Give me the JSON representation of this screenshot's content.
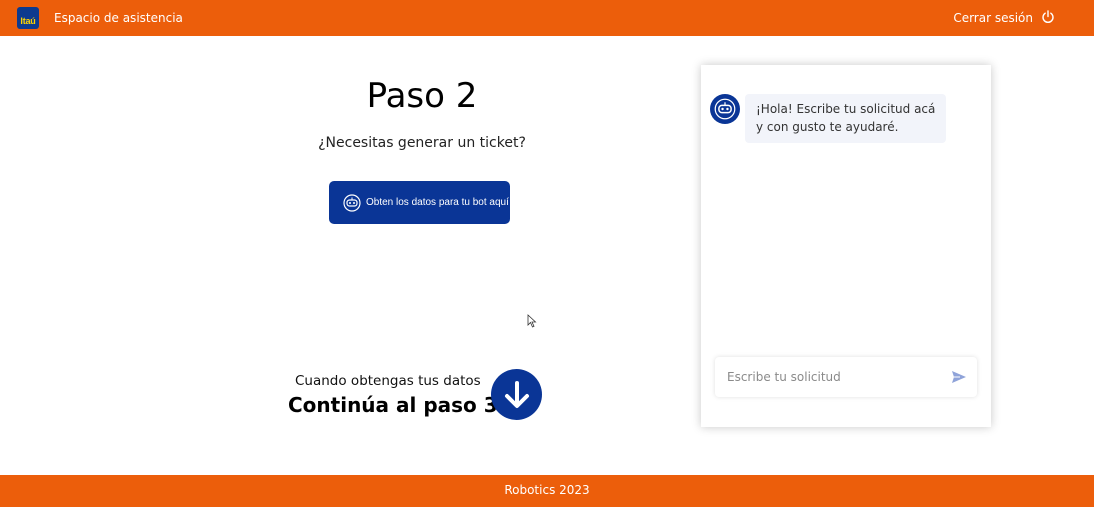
{
  "header": {
    "logo_text": "Itaú",
    "title": "Espacio de asistencia",
    "logout_label": "Cerrar sesión",
    "background_color": "#ec5e0b"
  },
  "main": {
    "step_title": "Paso 2",
    "question": "¿Necesitas generar un ticket?",
    "bot_button_label": "Obten los datos para tu bot aquí",
    "continue_subtitle": "Cuando obtengas tus datos",
    "continue_title": "Continúa al paso 3",
    "accent_color": "#0a3596"
  },
  "chat": {
    "messages": [
      {
        "sender": "bot",
        "text": "¡Hola! Escribe tu solicitud acá y con gusto te ayudaré."
      }
    ],
    "input_placeholder": "Escribe tu solicitud",
    "input_value": ""
  },
  "footer": {
    "text": "Robotics 2023"
  },
  "icons": [
    "power-icon",
    "robot-icon",
    "arrow-down-icon",
    "send-icon"
  ]
}
